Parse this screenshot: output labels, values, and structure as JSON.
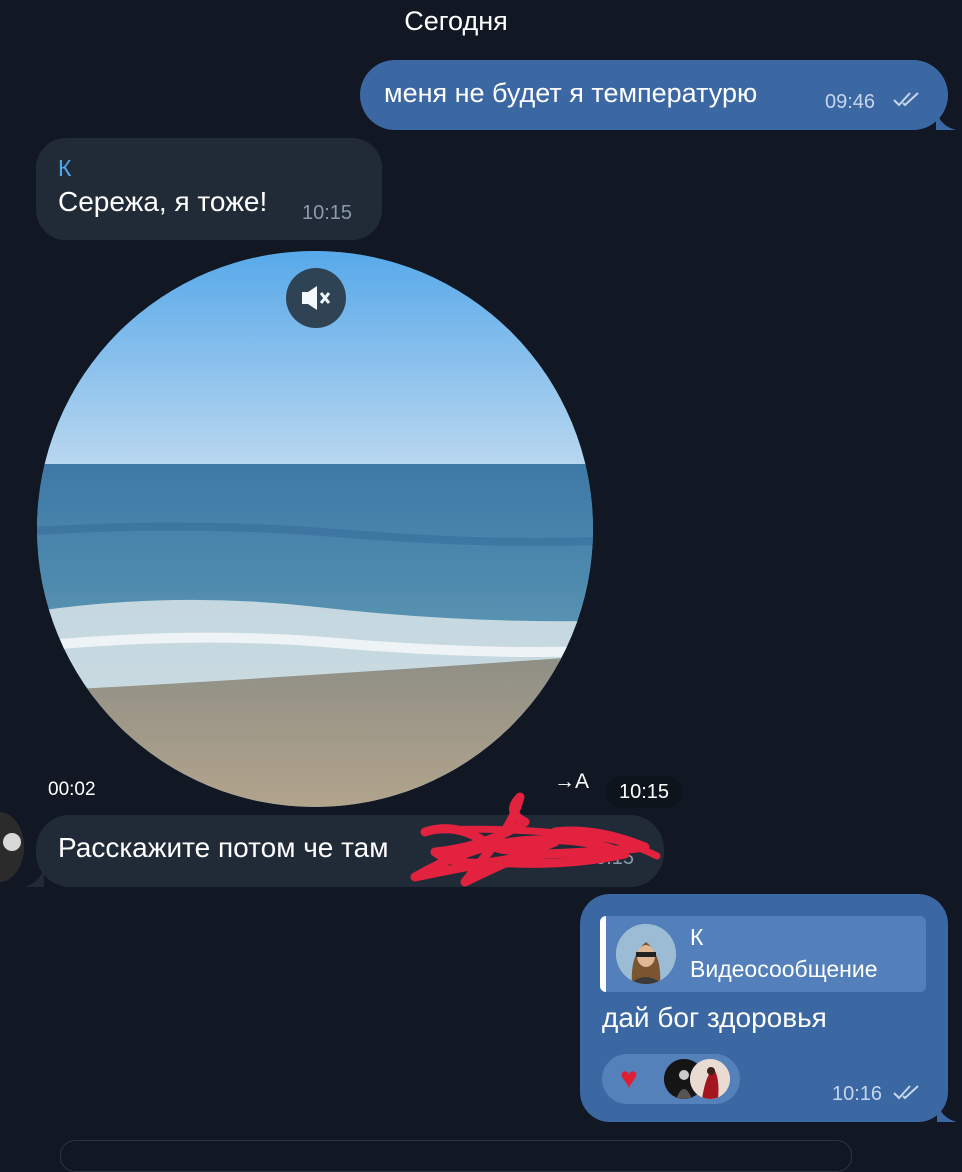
{
  "chat": {
    "date_header": "Сегодня",
    "messages": [
      {
        "direction": "outgoing",
        "text": "меня не будет я температурю",
        "time": "09:46",
        "status": "read"
      },
      {
        "direction": "incoming",
        "sender": "К",
        "text": "Сережа, я тоже!",
        "time": "10:15"
      },
      {
        "direction": "incoming",
        "type": "video-message",
        "duration": "00:02",
        "translate_label": "→A",
        "time": "10:15",
        "muted": true
      },
      {
        "direction": "incoming",
        "text": "Расскажите потом че там",
        "time": "10:15",
        "redacted": true
      },
      {
        "direction": "outgoing",
        "reply_to": {
          "sender": "К",
          "preview": "Видеосообщение"
        },
        "text": "дай бог здоровья",
        "time": "10:16",
        "status": "read",
        "reactions": [
          "heart"
        ]
      }
    ]
  },
  "colors": {
    "background": "#111823",
    "outgoing_bubble": "#3b67a2",
    "incoming_bubble": "#212b38",
    "sender_name": "#4ea6e6"
  },
  "icons": {
    "mute": "speaker-muted-icon",
    "read": "double-check-icon",
    "reaction": "heart-icon"
  }
}
